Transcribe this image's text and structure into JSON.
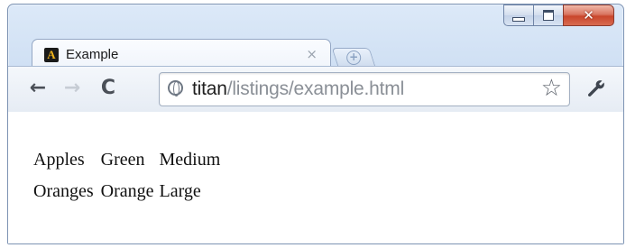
{
  "window": {
    "controls": {
      "minimize": "–",
      "maximize": "□",
      "close": "✕"
    }
  },
  "tab": {
    "title": "Example",
    "favicon_letter": "A",
    "close_glyph": "×",
    "favicon": "a-logo-icon"
  },
  "newtab": {
    "glyph": "+"
  },
  "toolbar": {
    "back_glyph": "←",
    "forward_glyph": "→",
    "reload_glyph": "C",
    "url_host": "titan",
    "url_path": "/listings/example.html",
    "star_glyph": "☆",
    "wrench_glyph": "🔧"
  },
  "page": {
    "rows": [
      [
        "Apples",
        "Green",
        "Medium"
      ],
      [
        "Oranges",
        "Orange",
        "Large"
      ]
    ]
  }
}
